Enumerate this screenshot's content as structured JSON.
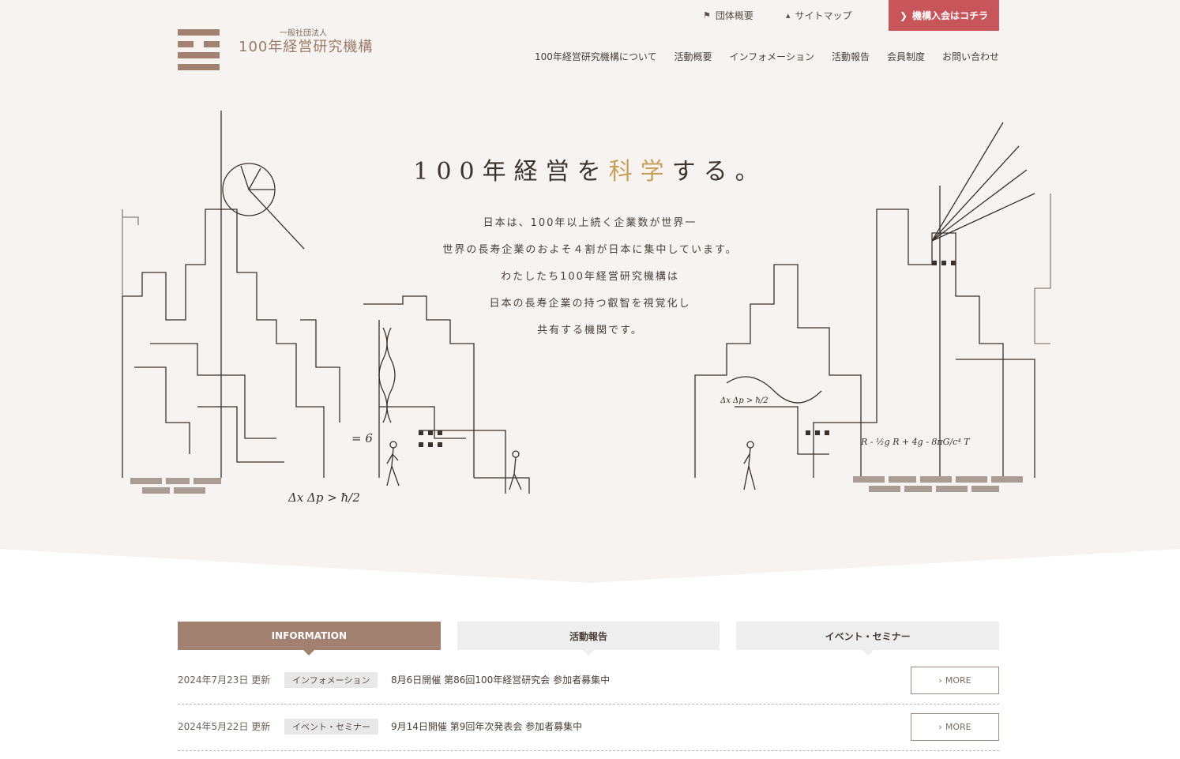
{
  "header": {
    "util_links": [
      {
        "label": "団体概要",
        "icon": "flag-icon"
      },
      {
        "label": "サイトマップ",
        "icon": "sitemap-icon"
      }
    ],
    "join_button": "機構入会はコチラ",
    "logo_sub": "一般社団法人",
    "logo_main": "100年経営研究機構",
    "nav": [
      "100年経営研究機構について",
      "活動概要",
      "インフォメーション",
      "活動報告",
      "会員制度",
      "お問い合わせ"
    ]
  },
  "hero": {
    "catch_before": "100年経営を",
    "catch_highlight": "科学",
    "catch_after": "する。",
    "lead": [
      "日本は、100年以上続く企業数が世界一",
      "世界の長寿企業のおよそ４割が日本に集中しています。",
      "わたしたち100年経営研究機構は",
      "日本の長寿企業の持つ叡智を視覚化し",
      "共有する機関です。"
    ],
    "formulas": [
      "Δx Δp > ħ/2",
      "= 6",
      "R - ½g R + 4g - 8πG/c⁴ T",
      "Δx Δp > ħ/2"
    ]
  },
  "tabs": [
    {
      "label": "INFORMATION",
      "active": true
    },
    {
      "label": "活動報告",
      "active": false
    },
    {
      "label": "イベント・セミナー",
      "active": false
    }
  ],
  "news": [
    {
      "date": "2024年7月23日 更新",
      "category": "インフォメーション",
      "title": "8月6日開催 第86回100年経営研究会 参加者募集中",
      "more": "MORE"
    },
    {
      "date": "2024年5月22日 更新",
      "category": "イベント・セミナー",
      "title": "9月14日開催 第9回年次発表会 参加者募集中",
      "more": "MORE"
    }
  ],
  "colors": {
    "accent": "#a28170",
    "join": "#c8555a",
    "highlight": "#c9a05a",
    "hero_bg": "#f6f3f0"
  }
}
